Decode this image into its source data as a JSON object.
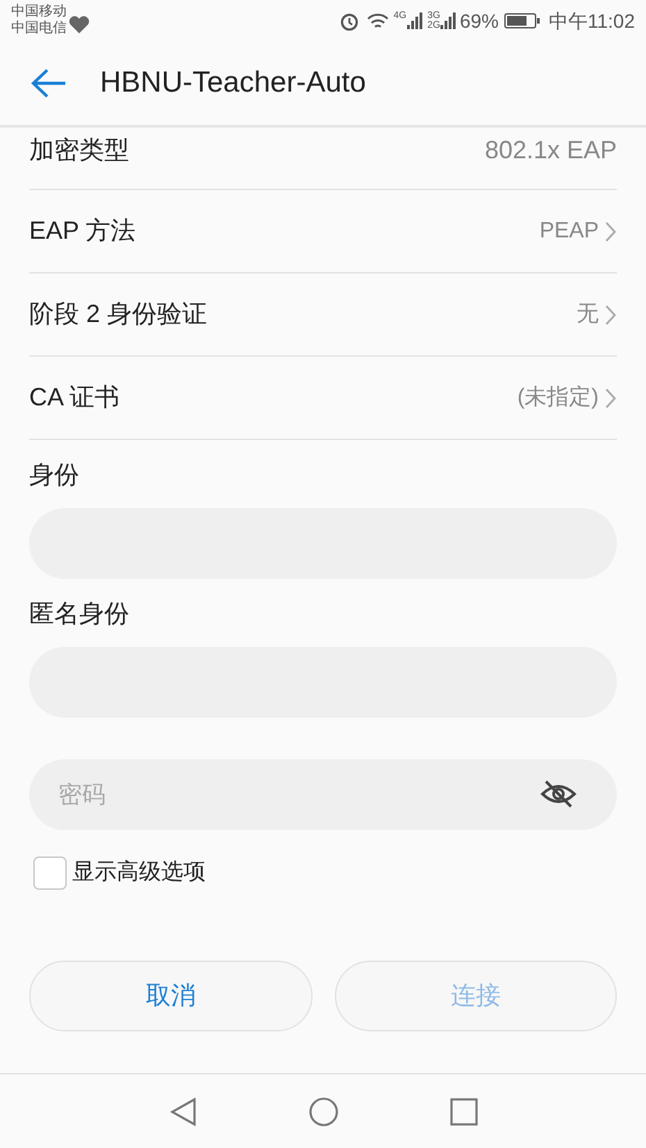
{
  "status_bar": {
    "carriers": [
      "中国移动",
      "中国电信"
    ],
    "network_labels": [
      "4G",
      "3G",
      "2G"
    ],
    "battery": "69%",
    "time": "中午11:02"
  },
  "header": {
    "title": "HBNU-Teacher-Auto"
  },
  "settings": [
    {
      "label": "加密类型",
      "value": "802.1x EAP",
      "kind": "static"
    },
    {
      "label": "EAP 方法",
      "value": "PEAP",
      "kind": "select"
    },
    {
      "label": "阶段 2 身份验证",
      "value": "无",
      "kind": "select"
    },
    {
      "label": "CA 证书",
      "value": "(未指定)",
      "kind": "select"
    }
  ],
  "fields": [
    {
      "label": "身份",
      "kind": "text"
    },
    {
      "label": "匿名身份",
      "kind": "text"
    },
    {
      "placeholder": "密码",
      "kind": "password"
    }
  ],
  "advanced_option": {
    "label": "显示高级选项",
    "checked": false
  },
  "buttons": [
    {
      "label": "取消",
      "disabled": false
    },
    {
      "label": "连接",
      "disabled": true
    }
  ]
}
